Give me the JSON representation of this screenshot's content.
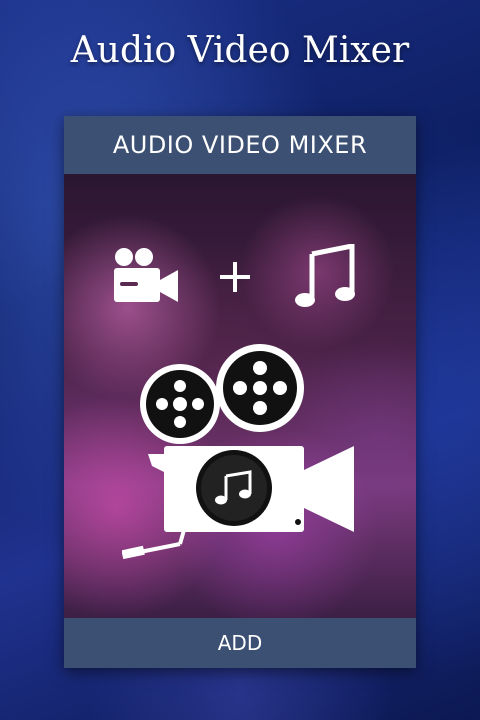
{
  "app": {
    "title": "Audio Video Mixer"
  },
  "card": {
    "header": "AUDIO VIDEO MIXER",
    "add_button": "ADD"
  },
  "icons": {
    "video_camera": "video-camera-icon",
    "plus": "plus-icon",
    "music_note": "music-note-icon",
    "projector_music": "movie-projector-music-icon"
  }
}
